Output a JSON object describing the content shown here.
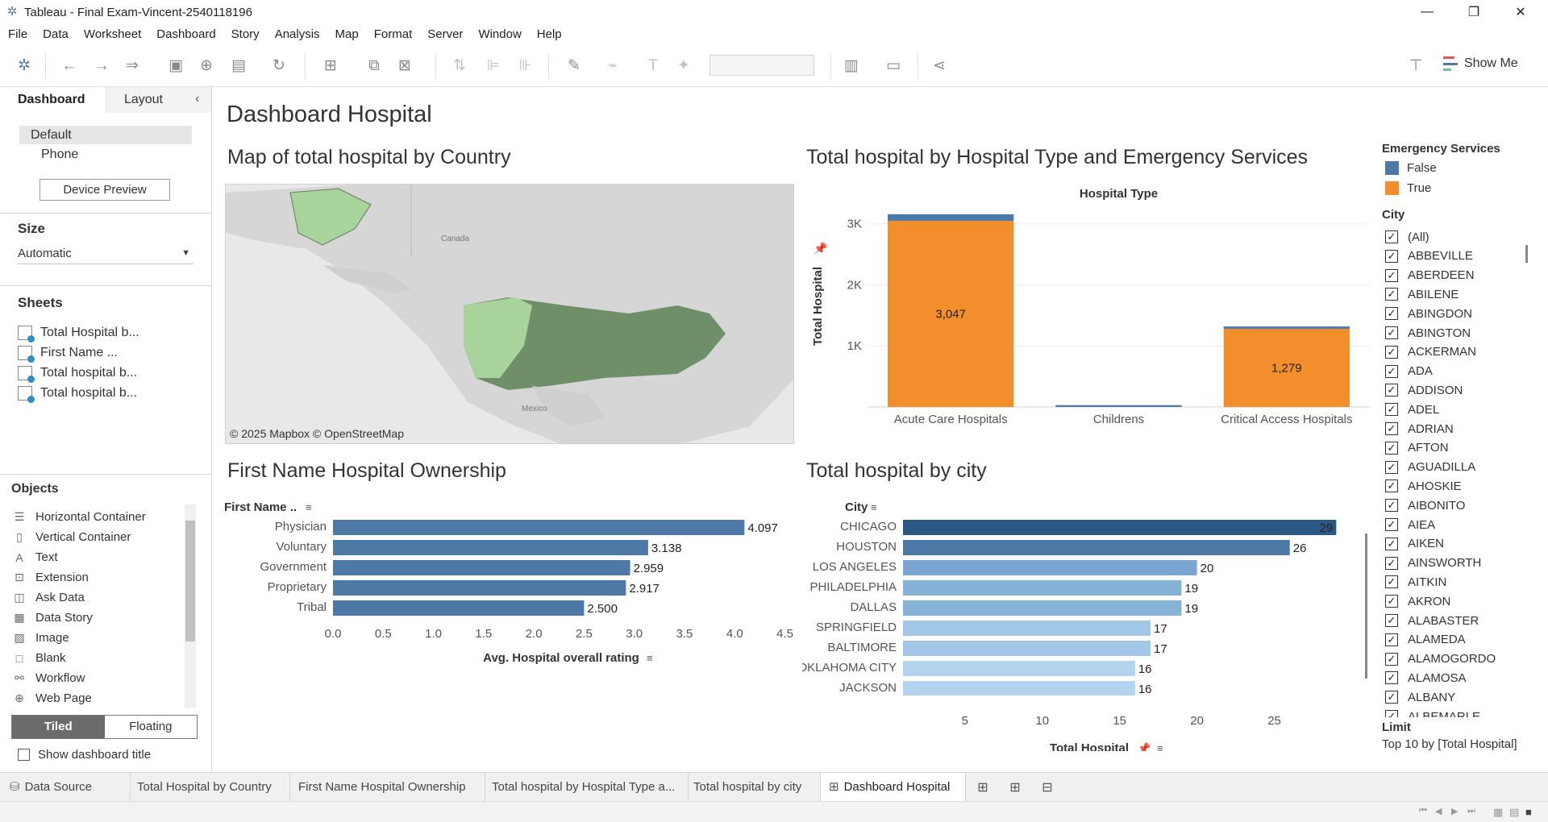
{
  "window": {
    "title": "Tableau - Final Exam-Vincent-2540118196",
    "minimize": "—",
    "restore": "❐",
    "close": "✕"
  },
  "menu": [
    "File",
    "Data",
    "Worksheet",
    "Dashboard",
    "Story",
    "Analysis",
    "Map",
    "Format",
    "Server",
    "Window",
    "Help"
  ],
  "toolbar": {
    "show_me_label": "Show Me"
  },
  "left_pane": {
    "tab_dashboard": "Dashboard",
    "tab_layout": "Layout",
    "device_default": "Default",
    "device_phone": "Phone",
    "device_preview": "Device Preview",
    "size_title": "Size",
    "size_value": "Automatic",
    "sheets_title": "Sheets",
    "sheets": [
      "Total Hospital b...",
      "First Name ...",
      "Total hospital b...",
      "Total hospital b..."
    ],
    "objects_title": "Objects",
    "objects": [
      {
        "label": "Horizontal Container",
        "icon": "horizontal-container-icon"
      },
      {
        "label": "Vertical Container",
        "icon": "vertical-container-icon"
      },
      {
        "label": "Text",
        "icon": "text-icon"
      },
      {
        "label": "Extension",
        "icon": "extension-icon"
      },
      {
        "label": "Ask Data",
        "icon": "ask-data-icon"
      },
      {
        "label": "Data Story",
        "icon": "data-story-icon"
      },
      {
        "label": "Image",
        "icon": "image-icon"
      },
      {
        "label": "Blank",
        "icon": "blank-icon"
      },
      {
        "label": "Workflow",
        "icon": "workflow-icon"
      },
      {
        "label": "Web Page",
        "icon": "web-page-icon"
      }
    ],
    "tiled": "Tiled",
    "floating": "Floating",
    "show_title": "Show dashboard title"
  },
  "dashboard": {
    "title": "Dashboard Hospital",
    "map": {
      "title": "Map of total hospital by Country",
      "credit": "© 2025 Mapbox © OpenStreetMap",
      "label_canada": "Canada",
      "label_mexico": "Mexico",
      "colors": {
        "fill": "#a8d39a",
        "dense": "#5f7f5a",
        "land": "#d4d4d4",
        "water": "#e8e8e8"
      }
    },
    "type_chart": {
      "title": "Total hospital by Hospital Type and Emergency Services"
    },
    "ownership_chart": {
      "title": "First Name Hospital Ownership"
    },
    "city_chart": {
      "title": "Total hospital by city"
    }
  },
  "chart_data": [
    {
      "type": "bar",
      "stacked": true,
      "title": "Total hospital by Hospital Type and Emergency Services",
      "header": "Hospital Type",
      "categories": [
        "Acute Care Hospitals",
        "Childrens",
        "Critical Access Hospitals"
      ],
      "series": [
        {
          "name": "True",
          "color": "#f28e2b",
          "values": [
            3047,
            0,
            1279
          ]
        },
        {
          "name": "False",
          "color": "#4e79a7",
          "values": [
            110,
            30,
            40
          ]
        }
      ],
      "data_labels": [
        "3,047",
        "",
        "1,279"
      ],
      "ylabel": "Total Hospital",
      "yticks": [
        "1K",
        "2K",
        "3K"
      ],
      "ytick_values": [
        1000,
        2000,
        3000
      ],
      "ylim": [
        0,
        3300
      ],
      "legend_title": "Emergency Services"
    },
    {
      "type": "bar",
      "orientation": "horizontal",
      "title": "First Name Hospital Ownership",
      "row_header": "First Name ..",
      "categories": [
        "Physician",
        "Voluntary",
        "Government",
        "Proprietary",
        "Tribal"
      ],
      "values": [
        4.097,
        3.138,
        2.959,
        2.917,
        2.5
      ],
      "data_labels": [
        "4.097",
        "3.138",
        "2.959",
        "2.917",
        "2.500"
      ],
      "xticks": [
        "0.0",
        "0.5",
        "1.0",
        "1.5",
        "2.0",
        "2.5",
        "3.0",
        "3.5",
        "4.0",
        "4.5"
      ],
      "xtick_values": [
        0,
        0.5,
        1,
        1.5,
        2,
        2.5,
        3,
        3.5,
        4,
        4.5
      ],
      "xlim": [
        0,
        4.6
      ],
      "xlabel": "Avg. Hospital overall rating",
      "color": "#4e79a7"
    },
    {
      "type": "bar",
      "orientation": "horizontal",
      "title": "Total hospital by city",
      "row_header": "City",
      "categories": [
        "CHICAGO",
        "HOUSTON",
        "LOS ANGELES",
        "PHILADELPHIA",
        "DALLAS",
        "SPRINGFIELD",
        "BALTIMORE",
        "OKLAHOMA CITY",
        "JACKSON"
      ],
      "values": [
        29,
        26,
        20,
        19,
        19,
        17,
        17,
        16,
        16
      ],
      "colors": [
        "#2a5783",
        "#4e79a7",
        "#7aa6d0",
        "#86b2d8",
        "#86b2d8",
        "#a3c7e6",
        "#a3c7e6",
        "#b3d3ee",
        "#b3d3ee"
      ],
      "xticks": [
        "5",
        "10",
        "15",
        "20",
        "25"
      ],
      "xtick_values": [
        5,
        10,
        15,
        20,
        25
      ],
      "xlim": [
        1,
        29.4
      ],
      "xlabel": "Total Hospital"
    }
  ],
  "legend": {
    "emergency_title": "Emergency Services",
    "items": [
      {
        "label": "False",
        "color": "#4e79a7"
      },
      {
        "label": "True",
        "color": "#f28e2b"
      }
    ],
    "city_title": "City",
    "cities": [
      "(All)",
      "ABBEVILLE",
      "ABERDEEN",
      "ABILENE",
      "ABINGDON",
      "ABINGTON",
      "ACKERMAN",
      "ADA",
      "ADDISON",
      "ADEL",
      "ADRIAN",
      "AFTON",
      "AGUADILLA",
      "AHOSKIE",
      "AIBONITO",
      "AIEA",
      "AIKEN",
      "AINSWORTH",
      "AITKIN",
      "AKRON",
      "ALABASTER",
      "ALAMEDA",
      "ALAMOGORDO",
      "ALAMOSA",
      "ALBANY",
      "ALBEMARLE"
    ],
    "limit_title": "Limit",
    "limit_value": "Top 10 by [Total Hospital]"
  },
  "bottom_tabs": {
    "data_source": "Data Source",
    "tabs": [
      "Total Hospital by Country",
      "First Name Hospital Ownership",
      "Total hospital by Hospital Type a...",
      "Total hospital by city"
    ],
    "active": "Dashboard Hospital"
  }
}
